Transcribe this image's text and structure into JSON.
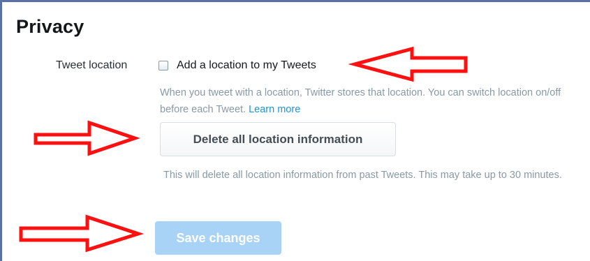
{
  "privacy": {
    "title": "Privacy",
    "tweet_location": {
      "label": "Tweet location",
      "checkbox_label": "Add a location to my Tweets",
      "checked": false,
      "help_text": "When you tweet with a location, Twitter stores that location. You can switch location on/off before each Tweet.",
      "learn_more": "Learn more"
    },
    "delete_location": {
      "button_label": "Delete all location information",
      "help_text": "This will delete all location information from past Tweets. This may take up to 30 minutes."
    },
    "save_button_label": "Save changes"
  },
  "annotations": {
    "arrow_color": "#ff1010"
  },
  "colors": {
    "link": "#1b95e0",
    "muted_text": "#8899a6",
    "save_button_disabled": "#a8d3f6",
    "frame_border": "#5b6fa8"
  }
}
